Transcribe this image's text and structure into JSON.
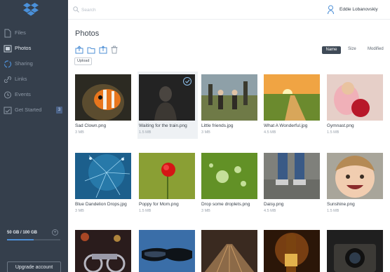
{
  "sidebar": {
    "items": [
      {
        "label": "Files",
        "icon": "file-icon",
        "active": false
      },
      {
        "label": "Photos",
        "icon": "photos-icon",
        "active": true
      },
      {
        "label": "Sharing",
        "icon": "sharing-icon",
        "active": false
      },
      {
        "label": "Links",
        "icon": "link-icon",
        "active": false
      },
      {
        "label": "Events",
        "icon": "events-icon",
        "active": false
      },
      {
        "label": "Get Started",
        "icon": "get-started-icon",
        "active": false
      }
    ],
    "get_started_badge": "3",
    "quota_text": "50 GB / 100 GB",
    "quota_used_fraction": 0.5,
    "upgrade_label": "Upgrade account"
  },
  "topbar": {
    "search_placeholder": "Search",
    "user_name": "Eddie Lobanovskiy"
  },
  "main": {
    "title": "Photos",
    "toolbar": {
      "tools": [
        "upload-icon",
        "new-folder-icon",
        "share-icon",
        "delete-icon"
      ],
      "tooltip": "Upload"
    },
    "sort": {
      "name": "Name",
      "size": "Size",
      "modified": "Modified",
      "active": "Name"
    },
    "photos": [
      {
        "name": "Sad Clown.png",
        "size": "3 MB"
      },
      {
        "name": "Waiting for the train.png",
        "size": "1.5 MB",
        "selected": true
      },
      {
        "name": "Little friends.jpg",
        "size": "3 MB"
      },
      {
        "name": "What A Wonderful.jpg",
        "size": "4.5 MB"
      },
      {
        "name": "Gymnast.png",
        "size": "1.5 MB"
      },
      {
        "name": "Blue Dandelion Drops.jpg",
        "size": "3 MB"
      },
      {
        "name": "Poppy for Mom.png",
        "size": "1.5 MB"
      },
      {
        "name": "Drop some droplets.png",
        "size": "3 MB"
      },
      {
        "name": "Daisy.png",
        "size": "4.5 MB"
      },
      {
        "name": "Sunshine.png",
        "size": "1.5 MB"
      },
      {
        "name": "",
        "size": ""
      },
      {
        "name": "",
        "size": ""
      },
      {
        "name": "",
        "size": ""
      },
      {
        "name": "",
        "size": ""
      },
      {
        "name": "",
        "size": ""
      }
    ]
  },
  "colors": {
    "sidebar_bg": "#353f4c",
    "accent_blue": "#4e8fd6",
    "sort_active_bg": "#3f4a57"
  }
}
